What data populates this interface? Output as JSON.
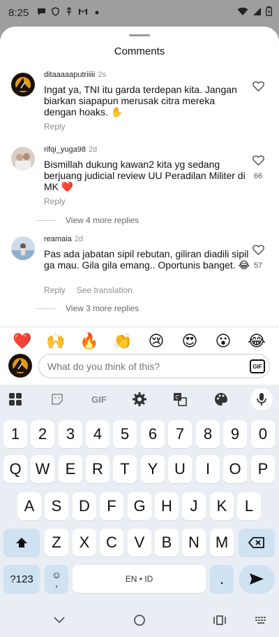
{
  "status_bar": {
    "time": "8:25",
    "icons_left": [
      "chat-bubble-icon",
      "shield-icon",
      "usb-icon",
      "gmail-icon",
      "dot-icon"
    ],
    "icons_right": [
      "wifi-icon",
      "signal-icon",
      "battery-icon"
    ]
  },
  "sheet": {
    "title": "Comments"
  },
  "comments": [
    {
      "username": "ditaaaaaputriiiii",
      "time": "2s",
      "text": "Ingat ya, TNI itu garda terdepan kita. Jangan biarkan siapapun merusak citra mereka dengan hoaks. ✋",
      "reply_label": "Reply",
      "likes": ""
    },
    {
      "username": "rifqi_yuga98",
      "time": "2d",
      "text": "Bismillah dukung kawan2 kita yg sedang berjuang judicial review UU Peradilan Militer di MK ❤️",
      "reply_label": "Reply",
      "likes": "66",
      "view_replies": "View 4 more replies"
    },
    {
      "username": "reamaia",
      "time": "2d",
      "text": "Pas ada jabatan sipil rebutan, giliran diadili sipil ga mau. Gila gila emang.. Oportunis banget. 😂",
      "reply_label": "Reply",
      "translate_label": "See translation",
      "likes": "57",
      "view_replies": "View 3 more replies"
    }
  ],
  "emoji_bar": [
    "❤️",
    "🙌",
    "🔥",
    "👏",
    "😢",
    "😍",
    "😮",
    "😂"
  ],
  "comment_input": {
    "placeholder": "What do you think of this?",
    "gif_label": "GIF"
  },
  "keyboard": {
    "toolbar": {
      "gif_label": "GIF"
    },
    "rows": [
      [
        "1",
        "2",
        "3",
        "4",
        "5",
        "6",
        "7",
        "8",
        "9",
        "0"
      ],
      [
        "Q",
        "W",
        "E",
        "R",
        "T",
        "Y",
        "U",
        "I",
        "O",
        "P"
      ],
      [
        "A",
        "S",
        "D",
        "F",
        "G",
        "H",
        "J",
        "K",
        "L"
      ],
      [
        "Z",
        "X",
        "C",
        "V",
        "B",
        "N",
        "M"
      ]
    ],
    "symbols_label": "?123",
    "emoji_key": "☺",
    "comma_key": ",",
    "space_label": "EN • ID",
    "period_key": "."
  },
  "colors": {
    "status_bar_bg": "#9e9e9e",
    "keyboard_bg": "#e9eef4",
    "function_key_bg": "#cfe2f2"
  }
}
